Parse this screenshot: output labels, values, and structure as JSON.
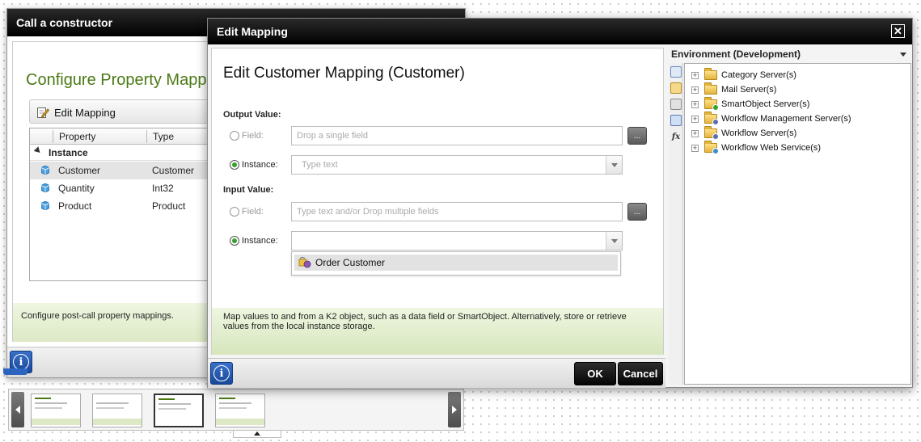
{
  "back_dialog": {
    "title": "Call a constructor",
    "heading": "Configure Property Mapp",
    "toolbar": {
      "edit_mapping_label": "Edit Mapping"
    },
    "grid": {
      "columns": [
        "Property",
        "Type"
      ],
      "group_label": "Instance",
      "rows": [
        {
          "property": "Customer",
          "type": "Customer",
          "selected": true
        },
        {
          "property": "Quantity",
          "type": "Int32",
          "selected": false
        },
        {
          "property": "Product",
          "type": "Product",
          "selected": false
        }
      ]
    },
    "footer_text": "Configure post-call property mappings.",
    "info_label": "i"
  },
  "thumbnail_strip": {
    "thumbnails": [
      "wizard-page-1",
      "wizard-page-2",
      "wizard-page-3",
      "wizard-page-4"
    ],
    "active_index": 2
  },
  "edit_mapping": {
    "title": "Edit Mapping",
    "close_glyph": "✕",
    "heading": "Edit Customer Mapping (Customer)",
    "output": {
      "label": "Output Value:",
      "field_label": "Field:",
      "field_placeholder": "Drop a single field",
      "instance_label": "Instance:",
      "instance_placeholder": "Type text",
      "selected": "instance"
    },
    "input": {
      "label": "Input Value:",
      "field_label": "Field:",
      "field_placeholder": "Type text and/or Drop multiple fields",
      "instance_label": "Instance:",
      "instance_value": "",
      "selected": "instance",
      "dropdown_options": [
        "Order Customer"
      ]
    },
    "ellipsis_label": "...",
    "footer_text": "Map values to and from a K2 object, such as a data field or SmartObject. Alternatively, store or retrieve values from the local instance storage.",
    "ok_label": "OK",
    "cancel_label": "Cancel",
    "info_label": "i"
  },
  "environment": {
    "header": "Environment (Development)",
    "side_icons": [
      "environment-icon",
      "fields-icon",
      "smartobject-icon",
      "settings-icon",
      "function-icon"
    ],
    "function_glyph": "fx",
    "tree": [
      {
        "label": "Category Server(s)",
        "icon": "category-server-icon",
        "badge": ""
      },
      {
        "label": "Mail Server(s)",
        "icon": "mail-server-icon",
        "badge": ""
      },
      {
        "label": "SmartObject Server(s)",
        "icon": "smartobject-server-icon",
        "badge": "#3aa02c"
      },
      {
        "label": "Workflow Management Server(s)",
        "icon": "workflow-management-server-icon",
        "badge": "#5a6fb0"
      },
      {
        "label": "Workflow Server(s)",
        "icon": "workflow-server-icon",
        "badge": "#5a6fb0"
      },
      {
        "label": "Workflow Web Service(s)",
        "icon": "workflow-web-service-icon",
        "badge": "#3a8fd0"
      }
    ],
    "expander_glyph": "+"
  },
  "colors": {
    "accent_green": "#4a7a14",
    "radio_selected": "#36a12a",
    "info_blue": "#2d64c0",
    "title_bar": "#000000"
  }
}
